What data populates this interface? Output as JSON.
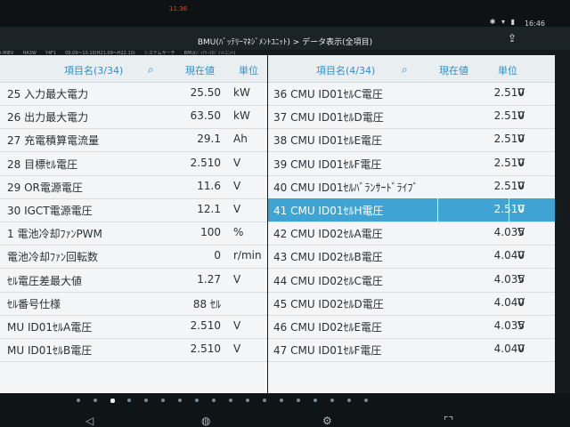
{
  "status_bar": {
    "time_red": "11:36",
    "clock": "16:46",
    "icons": [
      "bluetooth-icon",
      "wifi-icon",
      "battery-icon"
    ]
  },
  "header": {
    "title": "BMU(ﾊﾞｯﾃﾘｰﾏﾈｼﾞﾒﾝﾄﾕﾆｯﾄ) > データ表示(全項目)",
    "share_icon": "share-icon"
  },
  "breadcrumb": [
    "i-MiEV",
    "HA3W",
    "Y4F1",
    "09.09～10.10(H21.09～H22.10)",
    "システムサーチ",
    "BMU(ﾊﾞｯﾃﾘｰﾏﾈｼﾞﾒﾝﾄﾕﾆｯﾄ)"
  ],
  "left_panel": {
    "header": {
      "item_label": "項目名(3/34)",
      "value_label": "現在値",
      "unit_label": "単位"
    },
    "rows": [
      {
        "name": "25 入力最大電力",
        "value": "25.50",
        "unit": "kW"
      },
      {
        "name": "26 出力最大電力",
        "value": "63.50",
        "unit": "kW"
      },
      {
        "name": "27 充電積算電流量",
        "value": "29.1",
        "unit": "Ah"
      },
      {
        "name": "28 目標ｾﾙ電圧",
        "value": "2.510",
        "unit": "V"
      },
      {
        "name": "29 OR電源電圧",
        "value": "11.6",
        "unit": "V"
      },
      {
        "name": "30 IGCT電源電圧",
        "value": "12.1",
        "unit": "V"
      },
      {
        "name": "1 電池冷却ﾌｧﾝPWM",
        "value": "100",
        "unit": "%"
      },
      {
        "name": "電池冷却ﾌｧﾝ回転数",
        "value": "0",
        "unit": "r/min"
      },
      {
        "name": "ｾﾙ電圧差最大値",
        "value": "1.27",
        "unit": "V"
      },
      {
        "name": "ｾﾙ番号仕様",
        "value": "88 ｾﾙ",
        "unit": ""
      },
      {
        "name": "MU ID01ｾﾙA電圧",
        "value": "2.510",
        "unit": "V"
      },
      {
        "name": "MU ID01ｾﾙB電圧",
        "value": "2.510",
        "unit": "V"
      }
    ]
  },
  "right_panel": {
    "header": {
      "item_label": "項目名(4/34)",
      "value_label": "現在値",
      "unit_label": "単位"
    },
    "rows": [
      {
        "name": "36 CMU ID01ｾﾙC電圧",
        "value": "2.510",
        "unit": "V"
      },
      {
        "name": "37 CMU ID01ｾﾙD電圧",
        "value": "2.510",
        "unit": "V"
      },
      {
        "name": "38 CMU ID01ｾﾙE電圧",
        "value": "2.510",
        "unit": "V"
      },
      {
        "name": "39 CMU ID01ｾﾙF電圧",
        "value": "2.510",
        "unit": "V"
      },
      {
        "name": "40 CMU ID01ｾﾙﾊﾞﾗﾝｻｰﾄﾞﾗｲﾌﾞ",
        "value": "2.510",
        "unit": "V"
      },
      {
        "name": "41 CMU ID01ｾﾙH電圧",
        "value": "2.510",
        "unit": "V"
      },
      {
        "name": "42 CMU ID02ｾﾙA電圧",
        "value": "4.035",
        "unit": "V"
      },
      {
        "name": "43 CMU ID02ｾﾙB電圧",
        "value": "4.040",
        "unit": "V"
      },
      {
        "name": "44 CMU ID02ｾﾙC電圧",
        "value": "4.035",
        "unit": "V"
      },
      {
        "name": "45 CMU ID02ｾﾙD電圧",
        "value": "4.040",
        "unit": "V"
      },
      {
        "name": "46 CMU ID02ｾﾙE電圧",
        "value": "4.035",
        "unit": "V"
      },
      {
        "name": "47 CMU ID01ｾﾙF電圧",
        "value": "4.040",
        "unit": "V"
      }
    ],
    "selected_index": 5
  },
  "pagination": {
    "total": 18,
    "active": 2
  },
  "nav_icons": [
    "back-icon",
    "home-icon",
    "globe-icon",
    "settings-icon",
    "screen-icon"
  ],
  "colors": {
    "accent": "#3fa4d4",
    "header_text": "#2f8fca",
    "background": "#f3f5f6"
  }
}
